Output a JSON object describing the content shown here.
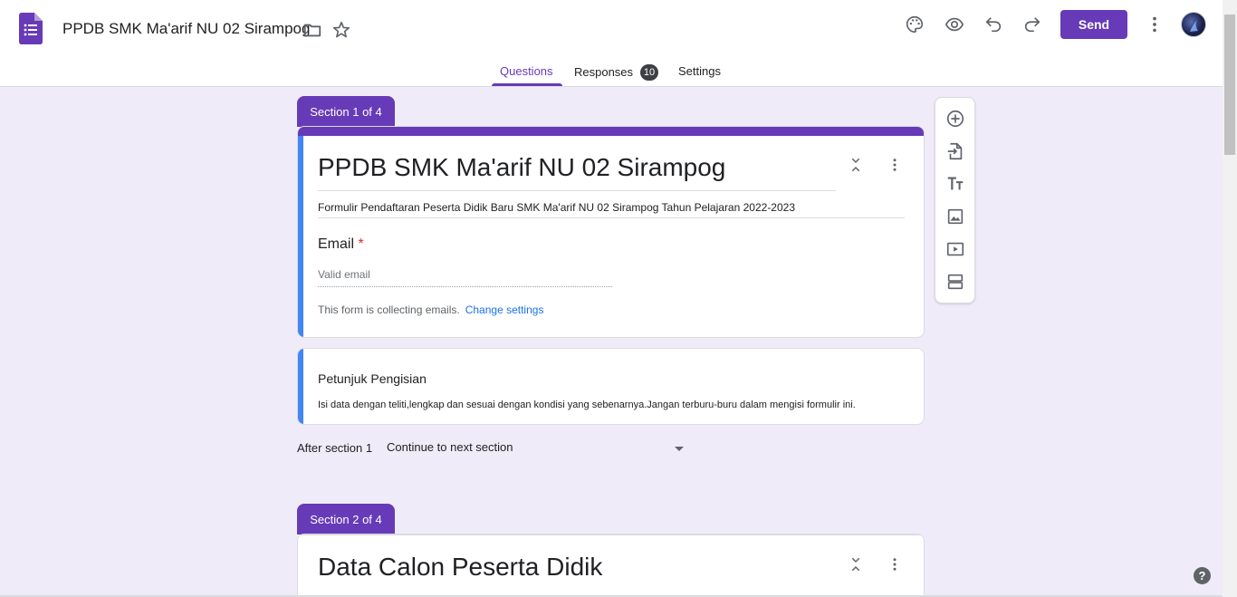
{
  "header": {
    "doc_title": "PPDB SMK Ma'arif NU 02 Sirampog",
    "send_label": "Send"
  },
  "tabs": [
    {
      "label": "Questions"
    },
    {
      "label": "Responses",
      "badge": "10"
    },
    {
      "label": "Settings"
    }
  ],
  "sections": [
    {
      "tag": "Section 1 of 4",
      "title": "PPDB SMK Ma'arif NU 02 Sirampog",
      "description": "Formulir Pendaftaran Peserta Didik Baru SMK Ma'arif NU 02 Sirampog Tahun Pelajaran 2022-2023",
      "email_question": {
        "label": "Email",
        "required_mark": "*",
        "placeholder": "Valid email",
        "note": "This form is collecting emails.",
        "note_link": "Change settings"
      },
      "text_item": {
        "title": "Petunjuk Pengisian",
        "description": "Isi data dengan teliti,lengkap dan sesuai dengan kondisi yang sebenarnya.Jangan terburu-buru dalam mengisi formulir ini."
      },
      "after_section": {
        "label": "After section 1",
        "value": "Continue to next section"
      }
    },
    {
      "tag": "Section 2 of 4",
      "title": "Data Calon Peserta Didik"
    }
  ],
  "help_label": "?",
  "colors": {
    "accent": "#673ab7",
    "background": "#f0ebf8",
    "focus_bar": "#4285f4",
    "link": "#1a73e8",
    "required": "#d93025"
  },
  "icons": {
    "header": [
      "forms-logo-icon",
      "folder-icon",
      "star-icon",
      "palette-icon",
      "preview-eye-icon",
      "undo-icon",
      "redo-icon",
      "more-vert-icon"
    ],
    "toolbar": [
      "add-question-icon",
      "import-questions-icon",
      "add-title-icon",
      "add-image-icon",
      "add-video-icon",
      "add-section-icon"
    ]
  }
}
